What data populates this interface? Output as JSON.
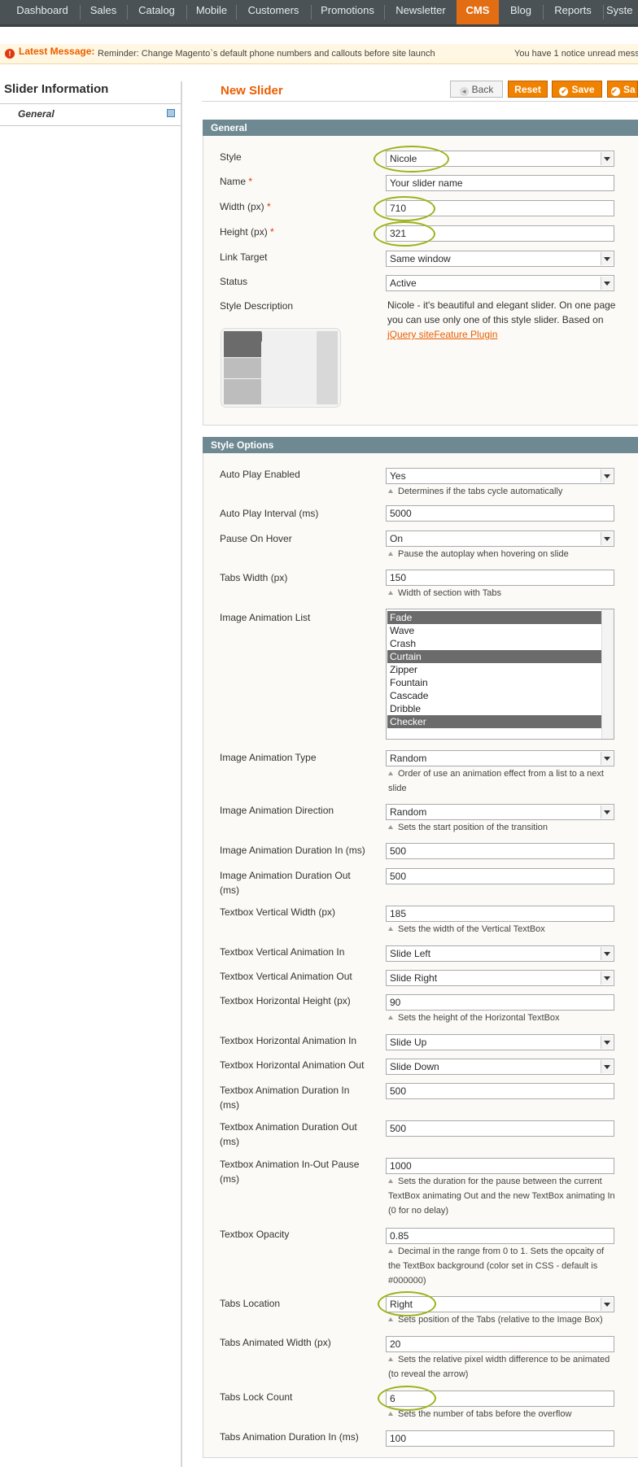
{
  "nav": [
    "Dashboard",
    "Sales",
    "Catalog",
    "Mobile",
    "Customers",
    "Promotions",
    "Newsletter",
    "CMS",
    "Blog",
    "Reports",
    "Syste"
  ],
  "notice": {
    "label": "Latest Message:",
    "text": "Reminder: Change Magento`s default phone numbers and callouts before site launch",
    "right": "You have 1 notice unread mess"
  },
  "sidebar": {
    "title": "Slider Information",
    "tab": "General"
  },
  "page": {
    "title": "New Slider",
    "back": "Back",
    "reset": "Reset",
    "save": "Save",
    "save_continue": "Sa"
  },
  "general": {
    "header": "General",
    "style_label": "Style",
    "style": "Nicole",
    "name_label": "Name",
    "name": "Your slider name",
    "width_label": "Width (px)",
    "width": "710",
    "height_label": "Height (px)",
    "height": "321",
    "link_label": "Link Target",
    "link": "Same window",
    "status_label": "Status",
    "status": "Active",
    "desc_label": "Style Description",
    "desc_text": "Nicole - it's beautiful and elegant slider. On one page you can use only one of this style slider.",
    "based_on": "Based on ",
    "plugin_link": "jQuery siteFeature Plugin"
  },
  "options": {
    "header": "Style Options",
    "autoplay_label": "Auto Play Enabled",
    "autoplay": "Yes",
    "autoplay_hint": "Determines if the tabs cycle automatically",
    "interval_label": "Auto Play Interval (ms)",
    "interval": "5000",
    "pause_label": "Pause On Hover",
    "pause": "On",
    "pause_hint": "Pause the autoplay when hovering on slide",
    "tabs_width_label": "Tabs Width (px)",
    "tabs_width": "150",
    "tabs_width_hint": "Width of section with Tabs",
    "anim_list_label": "Image Animation List",
    "anim_list": [
      "Fade",
      "Wave",
      "Crash",
      "Curtain",
      "Zipper",
      "Fountain",
      "Cascade",
      "Dribble",
      "Checker"
    ],
    "anim_type_label": "Image Animation Type",
    "anim_type": "Random",
    "anim_type_hint": "Order of use an animation effect from a list to a next slide",
    "anim_dir_label": "Image Animation Direction",
    "anim_dir": "Random",
    "anim_dir_hint": "Sets the start position of the transition",
    "dur_in_label": "Image Animation Duration In (ms)",
    "dur_in": "500",
    "dur_out_label": "Image Animation Duration Out (ms)",
    "dur_out": "500",
    "tbv_width_label": "Textbox Vertical Width (px)",
    "tbv_width": "185",
    "tbv_width_hint": "Sets the width of the Vertical TextBox",
    "tbv_in_label": "Textbox Vertical Animation In",
    "tbv_in": "Slide Left",
    "tbv_out_label": "Textbox Vertical Animation Out",
    "tbv_out": "Slide Right",
    "tbh_height_label": "Textbox Horizontal Height (px)",
    "tbh_height": "90",
    "tbh_height_hint": "Sets the height of the Horizontal TextBox",
    "tbh_in_label": "Textbox Horizontal Animation In",
    "tbh_in": "Slide Up",
    "tbh_out_label": "Textbox Horizontal Animation Out",
    "tbh_out": "Slide Down",
    "tb_dur_in_label": "Textbox Animation Duration In (ms)",
    "tb_dur_in": "500",
    "tb_dur_out_label": "Textbox Animation Duration Out (ms)",
    "tb_dur_out": "500",
    "tb_pause_label": "Textbox Animation In-Out Pause (ms)",
    "tb_pause": "1000",
    "tb_pause_hint": "Sets the duration for the pause between the current TextBox animating Out and the new TextBox animating In (0 for no delay)",
    "opacity_label": "Textbox Opacity",
    "opacity": "0.85",
    "opacity_hint": "Decimal in the range from 0 to 1. Sets the opcaity of the TextBox background (color set in CSS - default is #000000)",
    "tabs_loc_label": "Tabs Location",
    "tabs_loc": "Right",
    "tabs_loc_hint": "Sets position of the Tabs (relative to the Image Box)",
    "tabs_anim_w_label": "Tabs Animated Width (px)",
    "tabs_anim_w": "20",
    "tabs_anim_w_hint": "Sets the relative pixel width difference to be animated (to reveal the arrow)",
    "tabs_lock_label": "Tabs Lock Count",
    "tabs_lock": "6",
    "tabs_lock_hint": "Sets the number of tabs before the overflow",
    "tabs_dur_label": "Tabs Animation Duration In (ms)",
    "tabs_dur": "100"
  },
  "colors": {
    "accent": "#eb5e00",
    "header_bg": "#6f8992",
    "highlight_oval": "#9cb31c"
  }
}
